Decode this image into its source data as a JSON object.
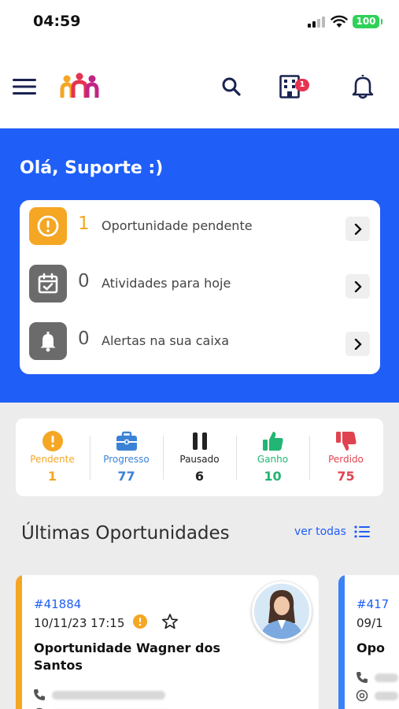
{
  "status_bar": {
    "time": "04:59",
    "battery": "100"
  },
  "navbar": {
    "notifications_badge": "1"
  },
  "greeting": "Olá, Suporte :)",
  "summary": [
    {
      "count": "1",
      "label": "Oportunidade pendente",
      "icon": "exclamation-icon",
      "icon_color": "#f5a623",
      "count_color": "#f5a623"
    },
    {
      "count": "0",
      "label": "Atividades para hoje",
      "icon": "calendar-check-icon",
      "icon_color": "#6b6b6b",
      "count_color": "#555555"
    },
    {
      "count": "0",
      "label": "Alertas na sua caixa",
      "icon": "bell-icon",
      "icon_color": "#6b6b6b",
      "count_color": "#555555"
    }
  ],
  "statuses": [
    {
      "label": "Pendente",
      "count": "1",
      "color": "#f5a623",
      "icon": "exclamation-circle-icon"
    },
    {
      "label": "Progresso",
      "count": "77",
      "color": "#3b82d6",
      "icon": "briefcase-icon"
    },
    {
      "label": "Pausado",
      "count": "6",
      "color": "#222222",
      "icon": "pause-icon"
    },
    {
      "label": "Ganho",
      "count": "10",
      "color": "#22b573",
      "icon": "thumbs-up-icon"
    },
    {
      "label": "Perdido",
      "count": "75",
      "color": "#e0434f",
      "icon": "thumbs-down-icon"
    }
  ],
  "latest": {
    "title": "Últimas Oportunidades",
    "see_all": "ver todas",
    "cards": [
      {
        "id": "#41884",
        "date": "10/11/23 17:15",
        "title": "Oportunidade Wagner dos Santos",
        "stripe_color": "#f5a623"
      },
      {
        "id": "#417",
        "date": "09/1",
        "title": "Opo",
        "stripe_color": "#3b82f6"
      }
    ]
  },
  "colors": {
    "accent": "#1f5ef7",
    "warning": "#f5a623",
    "success": "#22b573",
    "danger": "#e0434f"
  }
}
